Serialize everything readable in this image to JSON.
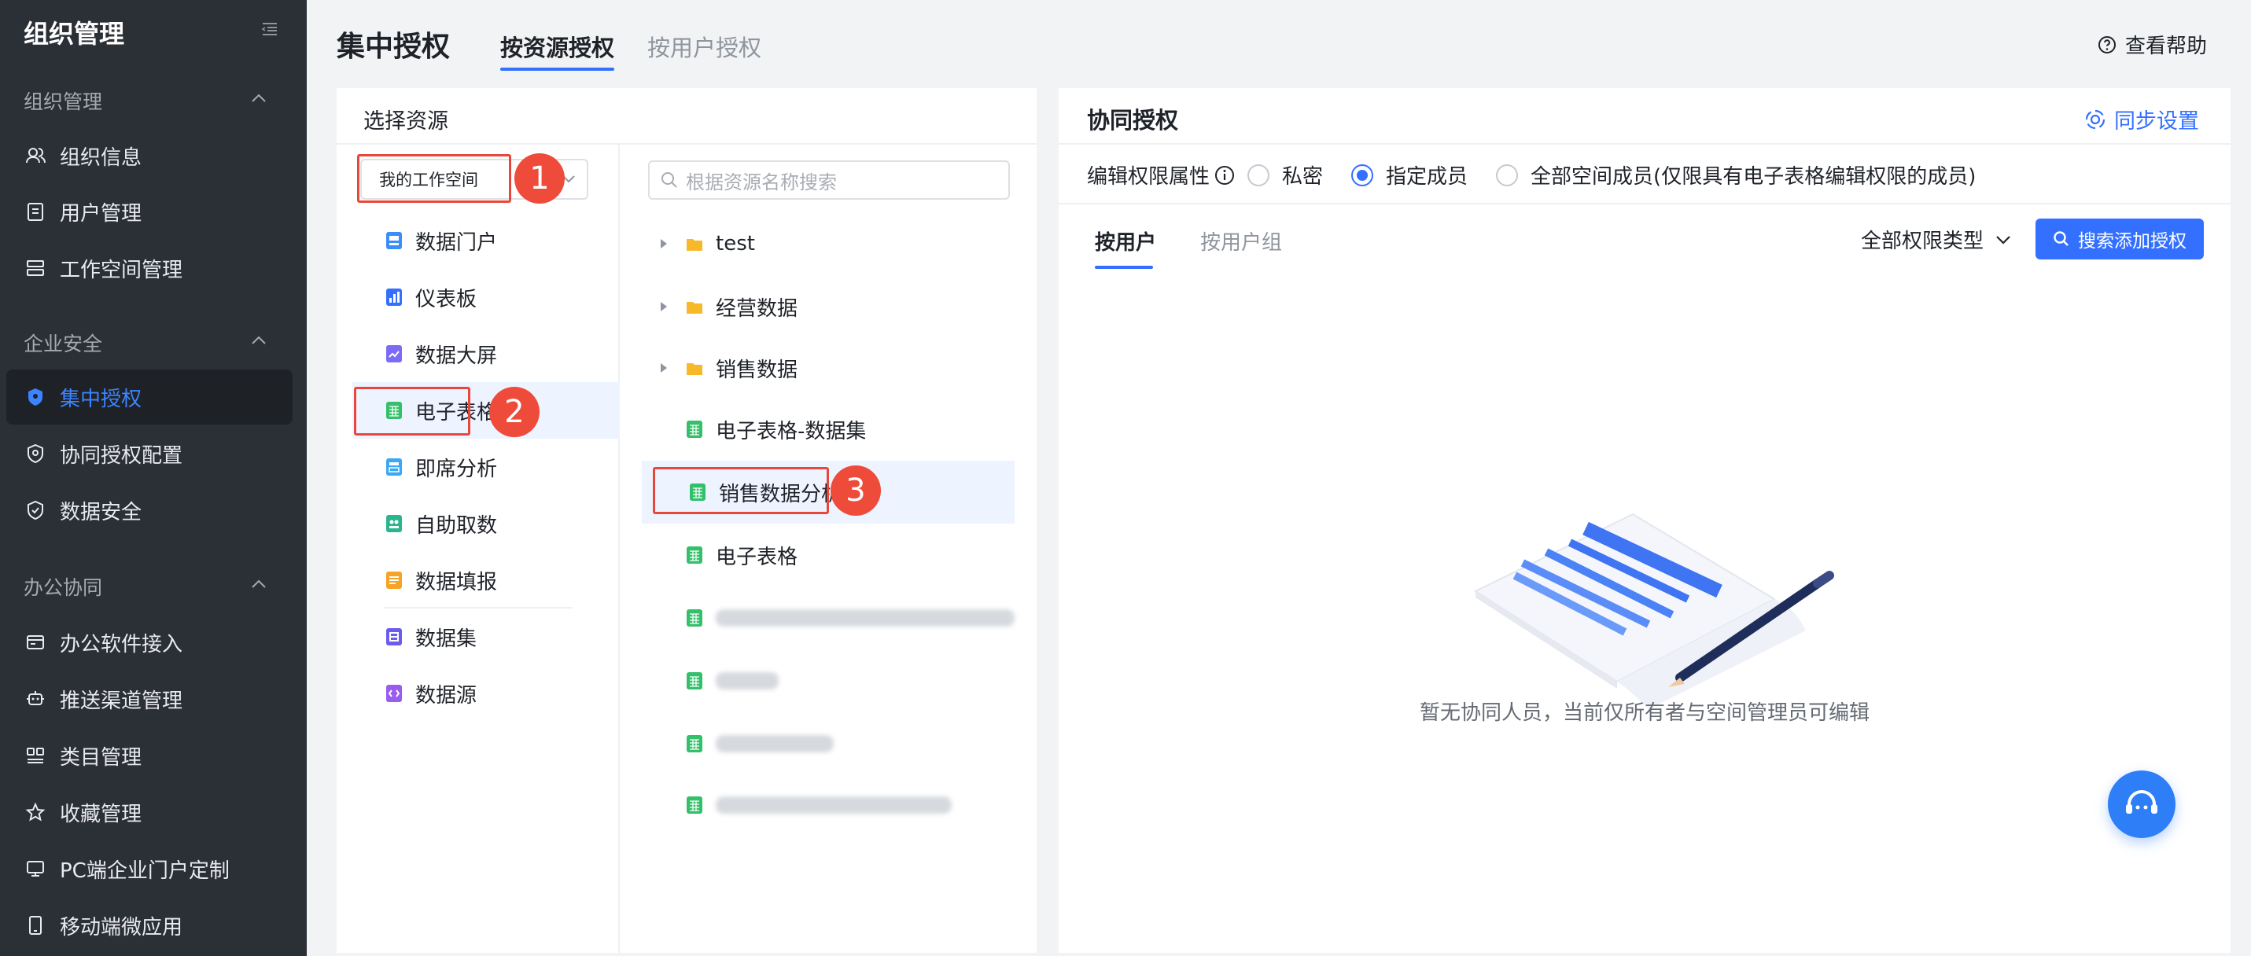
{
  "sidebar": {
    "title": "组织管理",
    "sections": [
      {
        "label": "组织管理",
        "items": [
          "组织信息",
          "用户管理",
          "工作空间管理"
        ]
      },
      {
        "label": "企业安全",
        "items": [
          "集中授权",
          "协同授权配置",
          "数据安全"
        ]
      },
      {
        "label": "办公协同",
        "items": [
          "办公软件接入",
          "推送渠道管理",
          "类目管理",
          "收藏管理",
          "PC端企业门户定制",
          "移动端微应用"
        ]
      }
    ],
    "active_item": "集中授权"
  },
  "header": {
    "title": "集中授权",
    "tabs": [
      "按资源授权",
      "按用户授权"
    ],
    "active_tab": "按资源授权",
    "help": "查看帮助"
  },
  "left_panel": {
    "title": "选择资源",
    "workspace_select": "我的工作空间",
    "resource_types": [
      "数据门户",
      "仪表板",
      "数据大屏",
      "电子表格",
      "即席分析",
      "自助取数",
      "数据填报",
      "数据集",
      "数据源"
    ],
    "selected_type": "电子表格",
    "search_placeholder": "根据资源名称搜索",
    "tree": [
      {
        "type": "folder",
        "label": "test"
      },
      {
        "type": "folder",
        "label": "经营数据"
      },
      {
        "type": "folder",
        "label": "销售数据"
      },
      {
        "type": "sheet",
        "label": "电子表格-数据集"
      },
      {
        "type": "sheet",
        "label": "销售数据分析"
      },
      {
        "type": "sheet",
        "label": "电子表格"
      }
    ],
    "selected_resource": "销售数据分析",
    "step_badges": [
      "1",
      "2",
      "3"
    ]
  },
  "right_panel": {
    "title": "协同授权",
    "sync_settings": "同步设置",
    "edit_permission_label": "编辑权限属性",
    "options": [
      "私密",
      "指定成员",
      "全部空间成员(仅限具有电子表格编辑权限的成员)"
    ],
    "selected_option": "指定成员",
    "sub_tabs": [
      "按用户",
      "按用户组"
    ],
    "active_sub_tab": "按用户",
    "perm_type": "全部权限类型",
    "add_button": "搜索添加授权",
    "empty_text": "暂无协同人员，当前仅所有者与空间管理员可编辑"
  },
  "colors": {
    "accent": "#3370ff",
    "sidebar_bg": "#2b2f36",
    "highlight_red": "#e8483b"
  }
}
